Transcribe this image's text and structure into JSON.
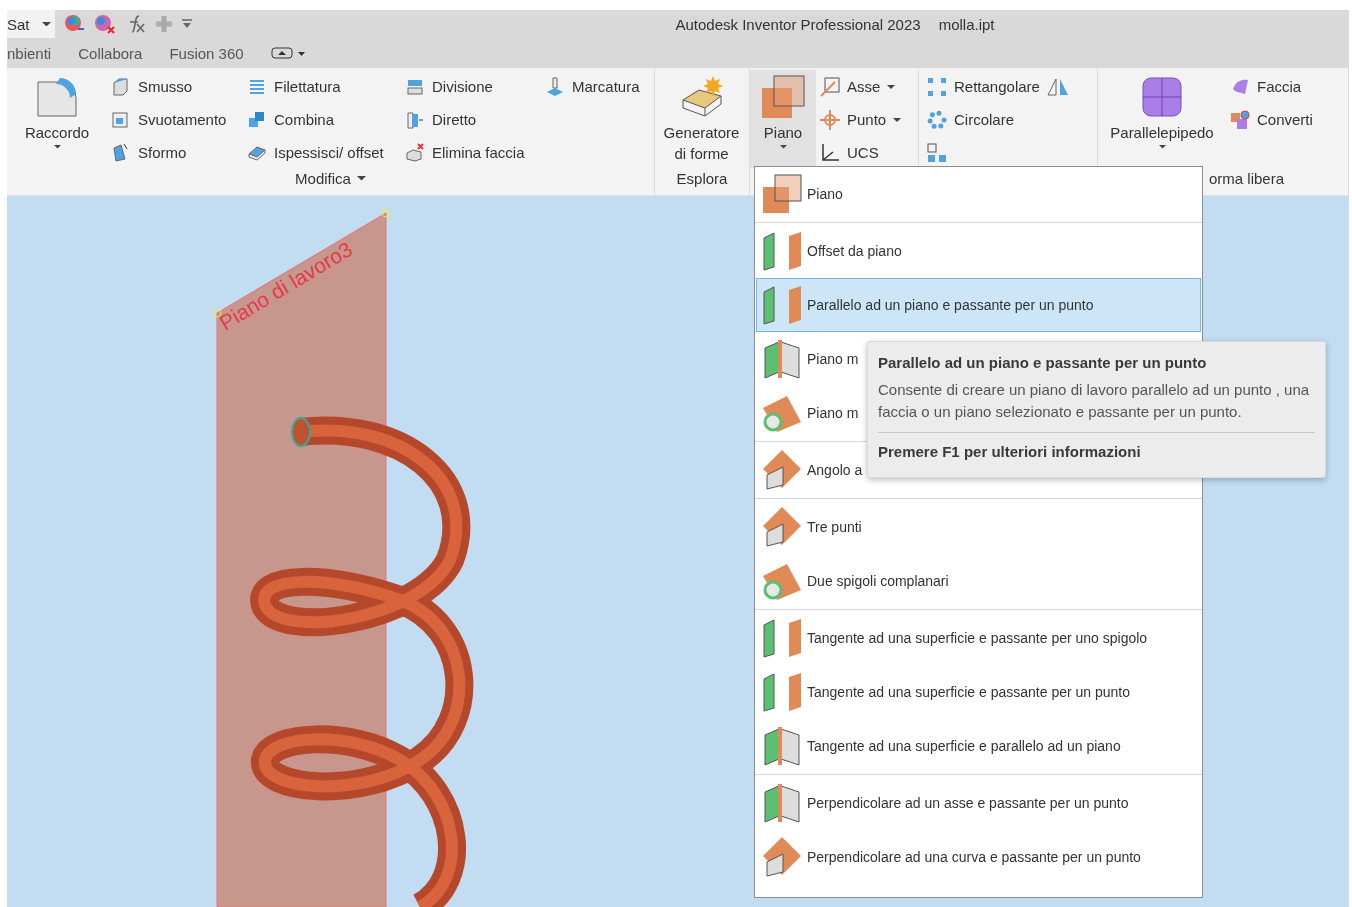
{
  "quick_access": {
    "style_field": "Sat"
  },
  "window": {
    "title": "Autodesk Inventor Professional 2023",
    "file": "molla.ipt"
  },
  "tabs": [
    {
      "label": "nbienti"
    },
    {
      "label": "Collabora"
    },
    {
      "label": "Fusion 360"
    }
  ],
  "ribbon": {
    "modifica": {
      "label": "Modifica",
      "large": "Raccordo",
      "columns": [
        [
          "Smusso",
          "Svuotamento",
          "Sformo"
        ],
        [
          "Filettatura",
          "Combina",
          "Ispessisci/ offset"
        ],
        [
          "Divisione",
          "Diretto",
          "Elimina faccia"
        ],
        [
          "Marcatura"
        ]
      ]
    },
    "esplora": {
      "label": "Esplora",
      "large": "Generatore di forme"
    },
    "lavoro": {
      "piano": {
        "label": "Piano",
        "expanded": true
      },
      "features": [
        {
          "label": "Asse",
          "dropdown": true
        },
        {
          "label": "Punto",
          "dropdown": true
        },
        {
          "label": "UCS",
          "dropdown": false
        }
      ],
      "patterns": [
        "Rettangolare",
        "Circolare"
      ]
    },
    "forma_libera": {
      "label": "orma libera",
      "large": "Parallelepipedo",
      "small": [
        "Faccia",
        "Converti"
      ]
    }
  },
  "viewport": {
    "plane_label": "Piano di lavoro3"
  },
  "menu": {
    "groups": [
      [
        {
          "label": "Piano",
          "selected": false
        }
      ],
      [
        {
          "label": "Offset da piano",
          "selected": false
        },
        {
          "label": "Parallelo ad un piano e passante per un punto",
          "selected": true
        },
        {
          "label": "Piano m",
          "selected": false
        },
        {
          "label": "Piano m",
          "selected": false
        }
      ],
      [
        {
          "label": "Angolo a",
          "selected": false
        }
      ],
      [
        {
          "label": "Tre punti",
          "selected": false
        },
        {
          "label": "Due spigoli complanari",
          "selected": false
        }
      ],
      [
        {
          "label": "Tangente ad una superficie e passante per uno spigolo",
          "selected": false
        },
        {
          "label": "Tangente ad una superficie e passante per un punto",
          "selected": false
        },
        {
          "label": "Tangente ad una superficie e parallelo ad un piano",
          "selected": false
        }
      ],
      [
        {
          "label": "Perpendicolare ad un asse e passante per un punto",
          "selected": false
        },
        {
          "label": "Perpendicolare ad una curva e passante per un punto",
          "selected": false
        }
      ]
    ]
  },
  "tooltip": {
    "title": "Parallelo ad un piano e passante per un punto",
    "description": "Consente di creare un piano di lavoro parallelo ad un punto , una faccia o un piano selezionato e passante per un punto.",
    "help": "Premere F1 per ulteriori informazioni"
  }
}
